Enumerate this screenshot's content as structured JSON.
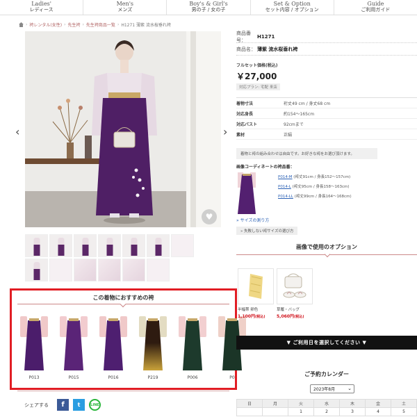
{
  "nav": [
    {
      "en": "Ladies'",
      "jp": "レディース"
    },
    {
      "en": "Men's",
      "jp": "メンズ"
    },
    {
      "en": "Boy's & Girl's",
      "jp": "男の子 / 女の子"
    },
    {
      "en": "Set & Option",
      "jp": "セット内容 / オプション"
    },
    {
      "en": "Guide",
      "jp": "ご利用ガイド"
    }
  ],
  "breadcrumb": {
    "items": [
      "袴レンタル(女性)",
      "先生袴",
      "先生袴商品一覧",
      "H1271 薄紫 流水桜垂れ袴"
    ]
  },
  "main_photo": {
    "prev": "‹",
    "next": "›",
    "fav": "♥"
  },
  "recommend": {
    "title": "この着物におすすめの袴",
    "items": [
      {
        "code": "P013",
        "skirt": "#4b1d6b",
        "sleeve": "#f0c9c9"
      },
      {
        "code": "P015",
        "skirt": "#5a2477",
        "sleeve": "#f2cccf"
      },
      {
        "code": "P016",
        "skirt": "#4e1f70",
        "sleeve": "#f0c9c9"
      },
      {
        "code": "P219",
        "skirt": "#2e1b10",
        "sleeve": "#e3dcc2"
      },
      {
        "code": "P006",
        "skirt": "#1d3a2c",
        "sleeve": "#f2cfd0"
      },
      {
        "code": "P0",
        "skirt": "#1b3527",
        "sleeve": "#efd0c8"
      }
    ]
  },
  "share": {
    "label": "シェアする",
    "fb": "f",
    "tw": "t",
    "ln": "LINE"
  },
  "product": {
    "number_label": "商品番号：",
    "number": "H1271",
    "name_label": "商品名：",
    "name": "薄紫 流水桜垂れ袴",
    "price_label": "フルセット価格(税込)",
    "price": "￥27,000",
    "plan_badge": "対応プラン: 宅配 来店",
    "specs": [
      {
        "k": "着物寸法",
        "v": "裄丈49 cm / 身丈68 cm"
      },
      {
        "k": "対応身長",
        "v": "約154〜165cm"
      },
      {
        "k": "対応バスト",
        "v": "92cmまで"
      },
      {
        "k": "素材",
        "v": "正絹"
      }
    ],
    "note": "着物と袴の組み合わせは自由です。お好きな袴をお選び頂けます。",
    "coord_title": "画像コーディネートの袴品番：",
    "coord_links": [
      {
        "code": "P014-M",
        "desc": "(袴丈91cm / 身長152〜157cm)"
      },
      {
        "code": "P014-L",
        "desc": "(袴丈95cm / 身長158〜163cm)"
      },
      {
        "code": "P014-LL",
        "desc": "(袴丈99cm / 身長164〜168cm)"
      }
    ],
    "size_link": "» サイズの測り方",
    "size_button": "» 失敗しない袴サイズの選び方"
  },
  "options": {
    "title": "画像で使用のオプション",
    "items": [
      {
        "name": "半幅帯 卵色",
        "price": "1,100円",
        "tax": "(税込)"
      },
      {
        "name": "草履・バッグ",
        "price": "5,060円",
        "tax": "(税込)"
      }
    ]
  },
  "date_bar": "▼ ご利用日を選択してください ▼",
  "calendar": {
    "title": "ご予約カレンダー",
    "month": "2023年8月",
    "weekdays": [
      "日",
      "月",
      "火",
      "水",
      "木",
      "金",
      "土"
    ],
    "row1": [
      "",
      "",
      "1",
      "2",
      "3",
      "4",
      "5"
    ]
  }
}
